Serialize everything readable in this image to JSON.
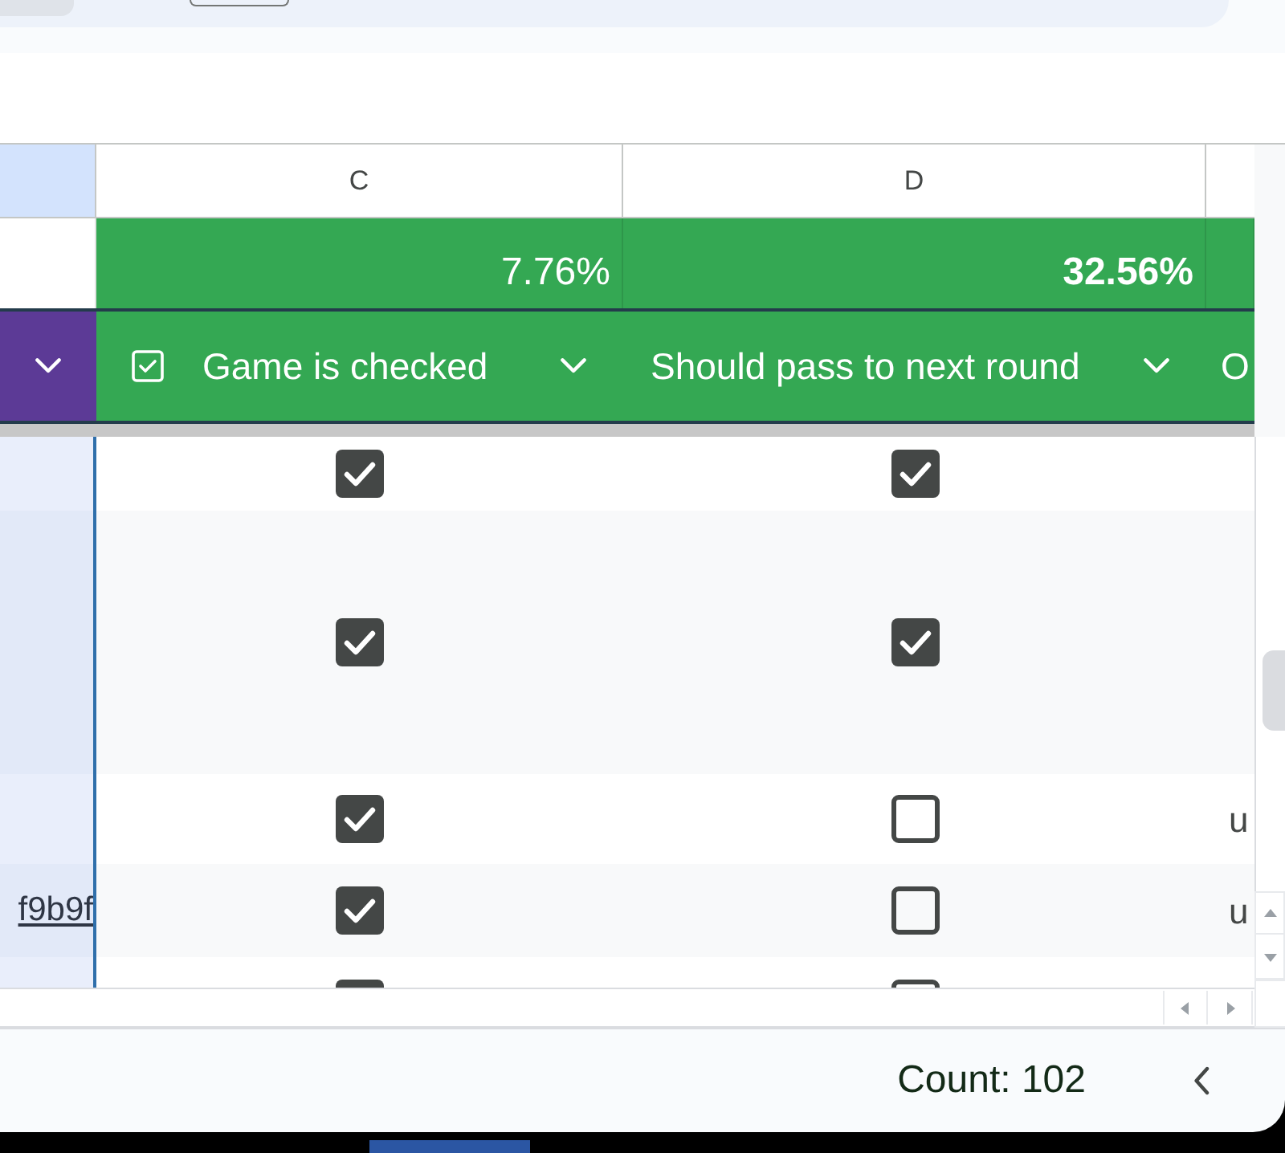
{
  "column_letters": [
    {
      "kind": "cut",
      "selected": true
    },
    {
      "kind": "letter",
      "letter": "C",
      "selected": false
    },
    {
      "kind": "letter",
      "letter": "D",
      "selected": false
    },
    {
      "kind": "cut",
      "selected": false
    }
  ],
  "summary_row": {
    "cells": [
      {
        "text": "7.76%",
        "bold": false
      },
      {
        "text": "32.56%",
        "bold": true
      }
    ]
  },
  "header_row": {
    "cells": [
      {
        "color": "#5c3a96",
        "dropdown": true
      },
      {
        "label": "Game is checked",
        "color": "#34a853",
        "type_icon": true,
        "dropdown": true
      },
      {
        "label": "Should pass to next round",
        "color": "#34a853",
        "type_icon": false,
        "dropdown": true
      },
      {
        "label": "O",
        "color": "#34a853",
        "dropdown": false
      }
    ]
  },
  "rows": [
    {
      "game_is_checked": true,
      "should_pass_to_next_round": true
    },
    {
      "game_is_checked": true,
      "should_pass_to_next_round": true
    },
    {
      "game_is_checked": true,
      "should_pass_to_next_round": false,
      "column_e": "u"
    },
    {
      "column_b": "f9b9f",
      "game_is_checked": true,
      "should_pass_to_next_round": false,
      "column_e": "u"
    },
    {
      "game_is_checked": true,
      "should_pass_to_next_round": false
    }
  ],
  "status_bar": {
    "summary": "Count: 102"
  }
}
